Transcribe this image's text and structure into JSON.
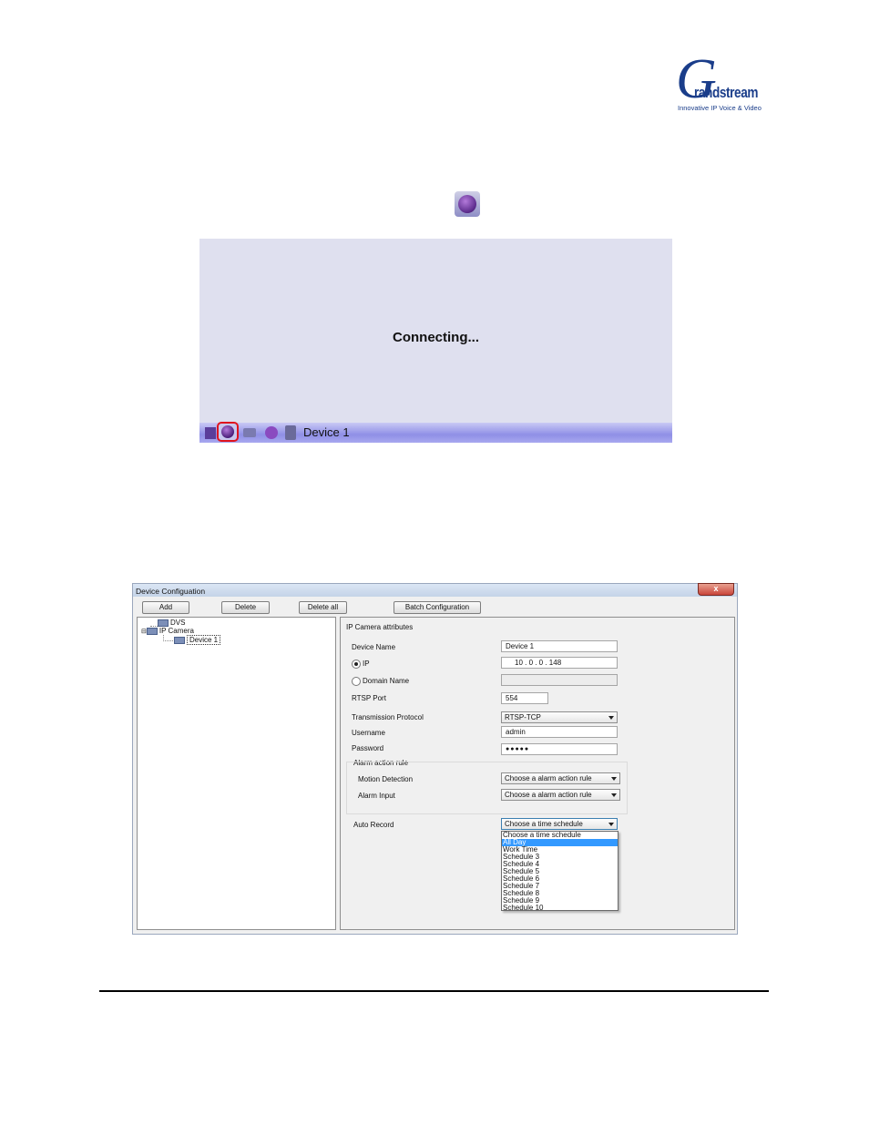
{
  "logo": {
    "letter": "G",
    "word": "randstream",
    "tagline": "Innovative IP Voice & Video",
    "color": "#1a3d8a"
  },
  "connecting_panel": {
    "status": "Connecting...",
    "device_label": "Device 1",
    "icons": [
      "stop-icon",
      "record-icon",
      "snapshot-icon",
      "ptz-icon",
      "speaker-icon"
    ]
  },
  "device_config": {
    "window_title": "Device Configuation",
    "close_glyph": "x",
    "toolbar": {
      "add": "Add",
      "delete": "Delete",
      "delete_all": "Delete all",
      "batch": "Batch Configuration"
    },
    "tree": {
      "dvs": "DVS",
      "ip_camera": "IP Camera",
      "device": "Device 1"
    },
    "attributes": {
      "header": "IP Camera attributes",
      "device_name_label": "Device Name",
      "device_name_value": "Device 1",
      "ip_label": "IP",
      "ip_value": "10  .  0  .  0  .  148",
      "domain_label": "Domain Name",
      "rtsp_label": "RTSP Port",
      "rtsp_value": "554",
      "protocol_label": "Transmission Protocol",
      "protocol_value": "RTSP-TCP",
      "username_label": "Username",
      "username_value": "admin",
      "password_label": "Password",
      "password_value": "●●●●●",
      "alarm_group": "Alarm action rule",
      "motion_label": "Motion Detection",
      "motion_value": "Choose a alarm action rule",
      "alarm_input_label": "Alarm Input",
      "alarm_input_value": "Choose a alarm action rule",
      "auto_record_label": "Auto Record",
      "auto_record_value": "Choose a time schedule",
      "schedule_options": [
        "Choose a time schedule",
        "All Day",
        "Work Time",
        "Schedule 3",
        "Schedule 4",
        "Schedule 5",
        "Schedule 6",
        "Schedule 7",
        "Schedule 8",
        "Schedule 9",
        "Schedule 10"
      ],
      "highlighted_option": "All Day"
    }
  }
}
